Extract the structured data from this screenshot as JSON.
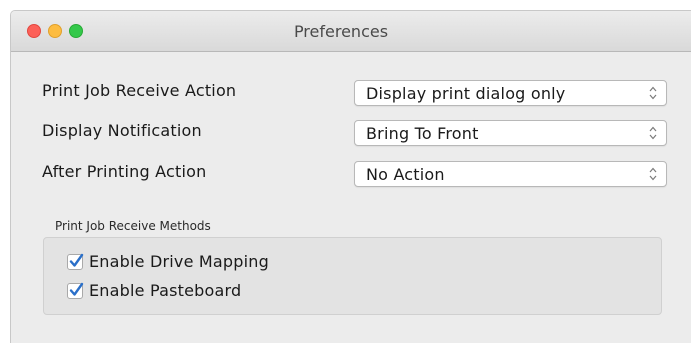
{
  "window": {
    "title": "Preferences"
  },
  "settings": [
    {
      "label": "Print Job Receive Action",
      "value": "Display print dialog only"
    },
    {
      "label": "Display Notification",
      "value": "Bring To Front"
    },
    {
      "label": "After Printing Action",
      "value": "No Action"
    }
  ],
  "receive_methods": {
    "title": "Print Job Receive Methods",
    "options": [
      {
        "label": "Enable Drive Mapping",
        "checked": true
      },
      {
        "label": "Enable Pasteboard",
        "checked": true
      }
    ]
  },
  "colors": {
    "checkmark": "#2a6fc9",
    "close_button": "#fc6058",
    "minimize_button": "#fdbc40",
    "zoom_button": "#34c84a"
  }
}
